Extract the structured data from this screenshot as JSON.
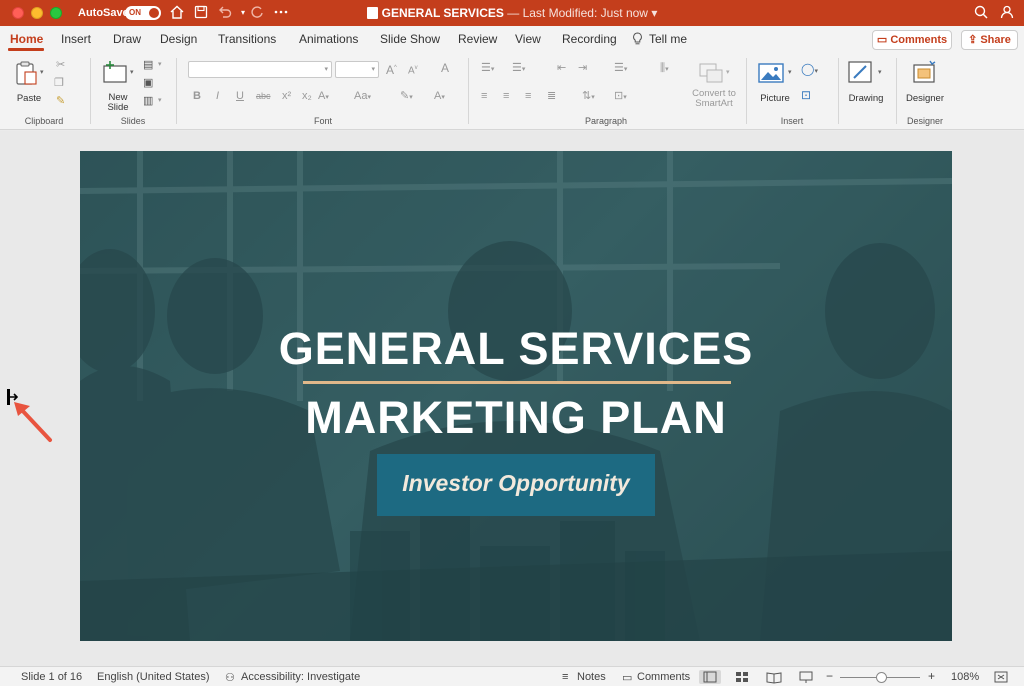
{
  "titlebar": {
    "autosave_label": "AutoSave",
    "autosave_state": "ON",
    "doc_name": "GENERAL SERVICES",
    "doc_status": " — Last Modified: Just now",
    "accent_color": "#c43e1c"
  },
  "tabs": [
    {
      "label": "Home",
      "active": true
    },
    {
      "label": "Insert"
    },
    {
      "label": "Draw"
    },
    {
      "label": "Design"
    },
    {
      "label": "Transitions"
    },
    {
      "label": "Animations"
    },
    {
      "label": "Slide Show"
    },
    {
      "label": "Review"
    },
    {
      "label": "View"
    },
    {
      "label": "Recording"
    },
    {
      "label": "Tell me"
    }
  ],
  "header_buttons": {
    "comments": "Comments",
    "share": "Share"
  },
  "ribbon": {
    "clipboard": {
      "group": "Clipboard",
      "paste": "Paste"
    },
    "slides": {
      "group": "Slides",
      "new_slide_1": "New",
      "new_slide_2": "Slide"
    },
    "font": {
      "group": "Font",
      "bold": "B",
      "italic": "I",
      "underline": "U",
      "strike": "abc",
      "superscript": "x²",
      "subscript": "x₂",
      "case": "Aa",
      "grow": "A",
      "shrink": "A",
      "clear": "A"
    },
    "paragraph": {
      "group": "Paragraph",
      "smartart_1": "Convert to",
      "smartart_2": "SmartArt"
    },
    "insert": {
      "group": "Insert",
      "picture": "Picture"
    },
    "drawing": {
      "label": "Drawing"
    },
    "designer": {
      "group": "Designer",
      "label": "Designer"
    }
  },
  "slide": {
    "title_line1": "GENERAL SERVICES",
    "title_line2": "MARKETING PLAN",
    "subtitle": "Investor Opportunity",
    "rule_color": "#e0b88a",
    "box_color": "#1d6a82"
  },
  "statusbar": {
    "slide_info": "Slide 1 of 16",
    "language": "English (United States)",
    "accessibility": "Accessibility: Investigate",
    "notes": "Notes",
    "comments": "Comments",
    "zoom": "108%",
    "zoom_minus": "−",
    "zoom_plus": "+"
  }
}
